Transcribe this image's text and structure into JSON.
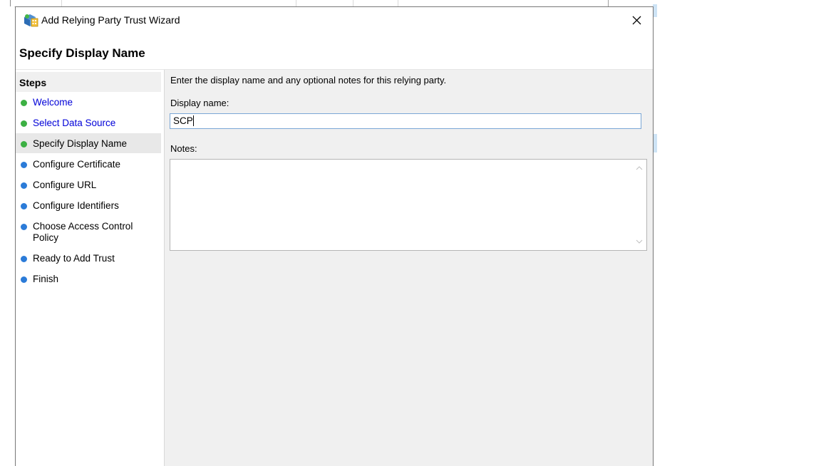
{
  "window": {
    "title": "Add Relying Party Trust Wizard",
    "close_label": "×"
  },
  "header": {
    "title": "Specify Display Name"
  },
  "steps": {
    "heading": "Steps",
    "items": [
      {
        "label": "Welcome",
        "state": "done"
      },
      {
        "label": "Select Data Source",
        "state": "done"
      },
      {
        "label": "Specify Display Name",
        "state": "current"
      },
      {
        "label": "Configure Certificate",
        "state": "pending"
      },
      {
        "label": "Configure URL",
        "state": "pending"
      },
      {
        "label": "Configure Identifiers",
        "state": "pending"
      },
      {
        "label": "Choose Access Control Policy",
        "state": "pending"
      },
      {
        "label": "Ready to Add Trust",
        "state": "pending"
      },
      {
        "label": "Finish",
        "state": "pending"
      }
    ]
  },
  "content": {
    "intro": "Enter the display name and any optional notes for this relying party.",
    "display_name_label": "Display name:",
    "display_name_value": "SCP",
    "notes_label": "Notes:",
    "notes_value": ""
  },
  "colors": {
    "done_dot": "#3cb043",
    "pending_dot": "#2b7bd8",
    "done_link": "#0000d8",
    "content_bg": "#f0f0f0",
    "input_border_focus": "#7aa7d6"
  }
}
